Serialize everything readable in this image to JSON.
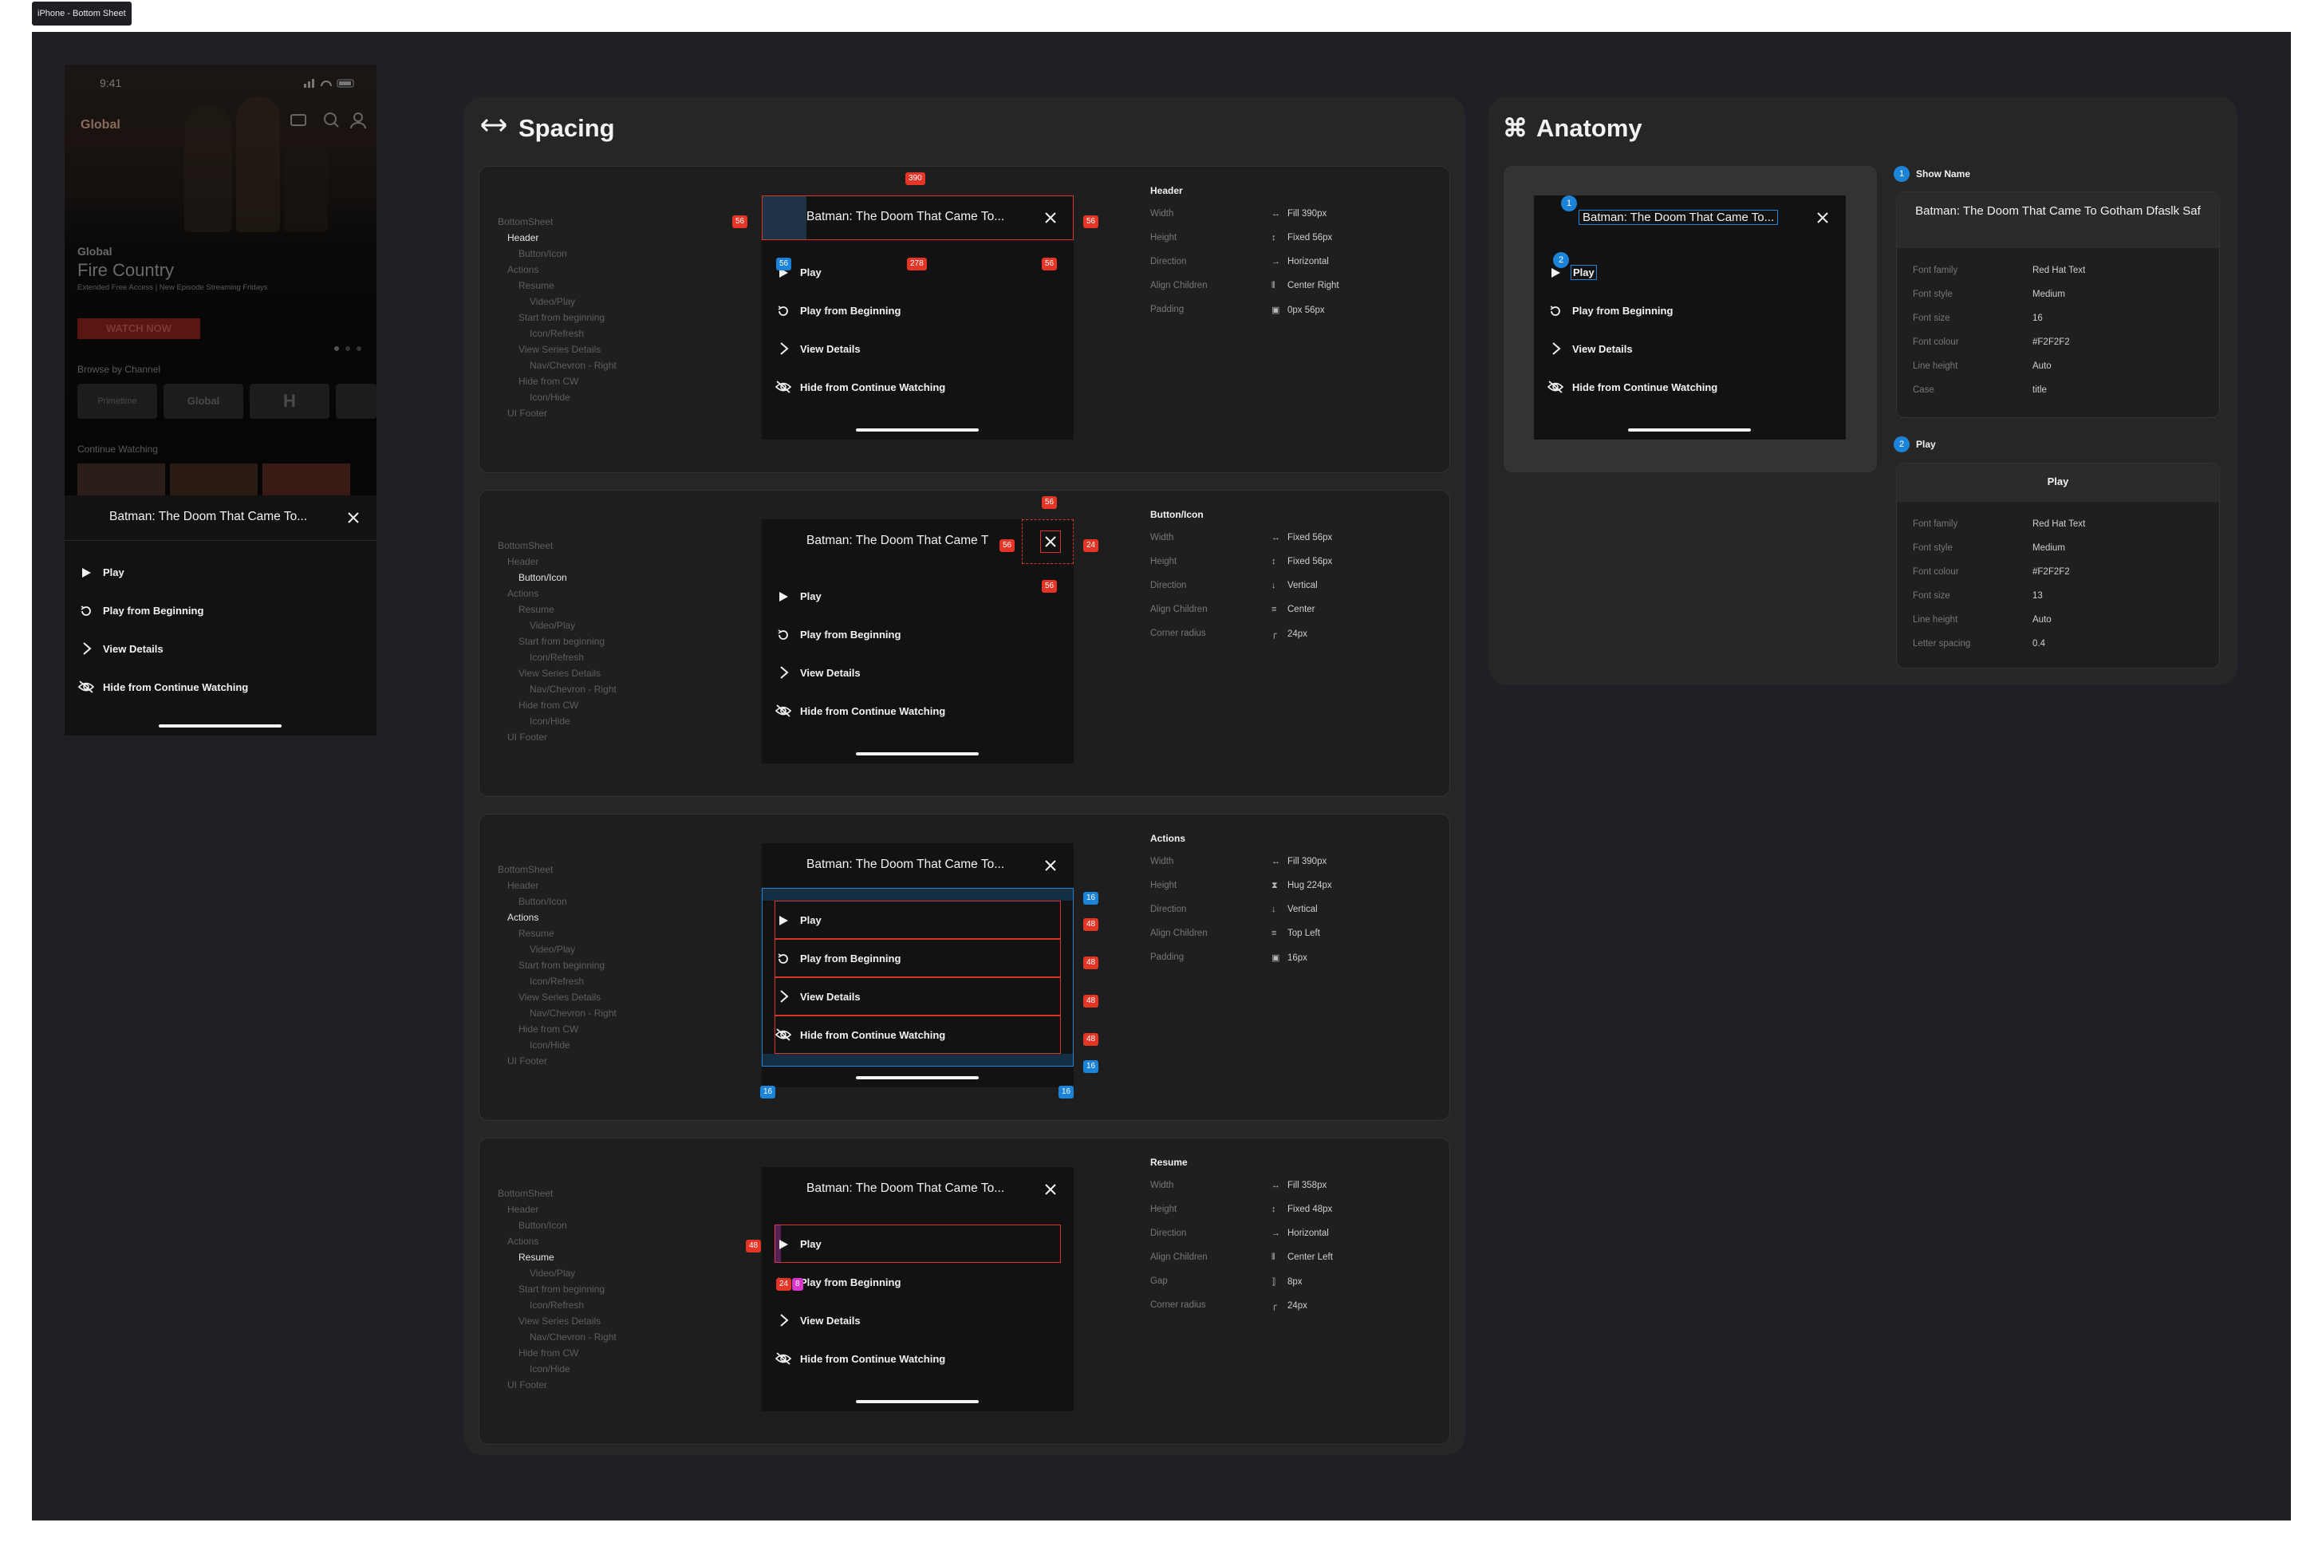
{
  "frame_tag": "iPhone - Bottom Sheet",
  "colors": {
    "frame_bg": "#1e2026",
    "panel": "#262626",
    "sheet": "#121212",
    "text": "#F2F2F2",
    "badge_red": "#e53527",
    "badge_blue": "#1c84d8"
  },
  "phone": {
    "time": "9:41",
    "logo": "Global",
    "hero_label": "Global",
    "hero_title": "Fire Country",
    "hero_sub": "Extended Free Access | New Episode Streaming Fridays",
    "watch_now": "WATCH NOW",
    "browse": "Browse by Channel",
    "continue": "Continue Watching",
    "channels": [
      "Primetime",
      "Global",
      "H"
    ],
    "sheet_title": "Batman: The Doom That Came To...",
    "actions": [
      "Play",
      "Play from Beginning",
      "View Details",
      "Hide from Continue Watching"
    ]
  },
  "spacing": {
    "title": "Spacing",
    "tree": [
      "BottomSheet",
      "Header",
      "Button/Icon",
      "Actions",
      "Resume",
      "Video/Play",
      "Start from beginning",
      "Icon/Refresh",
      "View Series Details",
      "Nav/Chevron - Right",
      "Hide from CW",
      "Icon/Hide",
      "UI Footer"
    ],
    "mock_title_a": "Batman: The Doom That Came To...",
    "mock_title_b": "Batman: The Doom That Came T",
    "actions": [
      "Play",
      "Play from Beginning",
      "View Details",
      "Hide from Continue Watching"
    ],
    "sections": [
      {
        "name": "Header",
        "props": [
          [
            "Width",
            "Fill 390px"
          ],
          [
            "Height",
            "Fixed 56px"
          ],
          [
            "Direction",
            "Horizontal"
          ],
          [
            "Align Children",
            "Center Right"
          ],
          [
            "Padding",
            "0px 56px"
          ]
        ],
        "badges": {
          "top": "390",
          "left": "56",
          "right": "56",
          "mid": "278",
          "mid_r": "56",
          "blue": "56"
        }
      },
      {
        "name": "Button/Icon",
        "props": [
          [
            "Width",
            "Fixed 56px"
          ],
          [
            "Height",
            "Fixed 56px"
          ],
          [
            "Direction",
            "Vertical"
          ],
          [
            "Align Children",
            "Center"
          ],
          [
            "Corner radius",
            "24px"
          ]
        ],
        "badges": {
          "top": "56",
          "bottom": "56",
          "left": "56",
          "right": "24"
        }
      },
      {
        "name": "Actions",
        "props": [
          [
            "Width",
            "Fill 390px"
          ],
          [
            "Height",
            "Hug 224px"
          ],
          [
            "Direction",
            "Vertical"
          ],
          [
            "Align Children",
            "Top Left"
          ],
          [
            "Padding",
            "16px"
          ]
        ],
        "badges": {
          "row": "48",
          "pad": "16"
        }
      },
      {
        "name": "Resume",
        "props": [
          [
            "Width",
            "Fill 358px"
          ],
          [
            "Height",
            "Fixed 48px"
          ],
          [
            "Direction",
            "Horizontal"
          ],
          [
            "Align Children",
            "Center Left"
          ],
          [
            "Gap",
            "8px"
          ],
          [
            "Corner radius",
            "24px"
          ]
        ],
        "badges": {
          "left": "48",
          "a": "24",
          "b": "8"
        }
      }
    ]
  },
  "anatomy": {
    "title": "Anatomy",
    "mock_title": "Batman: The Doom That Came To...",
    "actions": [
      "Play",
      "Play from Beginning",
      "View Details",
      "Hide from Continue Watching"
    ],
    "markers": [
      "1",
      "2"
    ],
    "show_name": {
      "label": "Show Name",
      "preview": "Batman: The Doom That Came To Gotham Dfaslk Saf",
      "props": [
        [
          "Font family",
          "Red Hat Text"
        ],
        [
          "Font style",
          "Medium"
        ],
        [
          "Font size",
          "16"
        ],
        [
          "Font colour",
          "#F2F2F2"
        ],
        [
          "Line height",
          "Auto"
        ],
        [
          "Case",
          "title"
        ]
      ]
    },
    "play": {
      "label": "Play",
      "preview": "Play",
      "props": [
        [
          "Font family",
          "Red Hat Text"
        ],
        [
          "Font style",
          "Medium"
        ],
        [
          "Font colour",
          "#F2F2F2"
        ],
        [
          "Font size",
          "13"
        ],
        [
          "Line height",
          "Auto"
        ],
        [
          "Letter spacing",
          "0.4"
        ]
      ]
    }
  }
}
